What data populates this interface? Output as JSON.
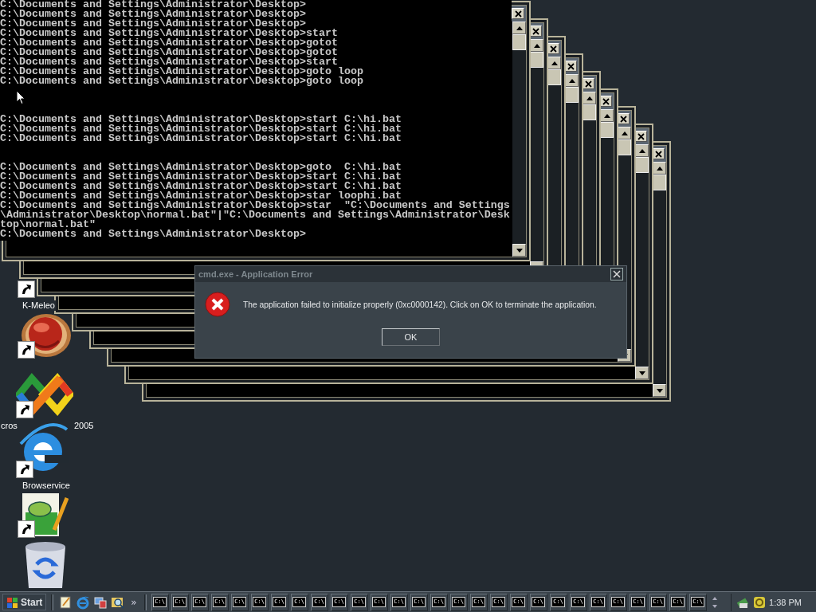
{
  "console": {
    "blocks": [
      [
        "C:\\Documents and Settings\\Administrator\\Desktop>",
        "C:\\Documents and Settings\\Administrator\\Desktop>",
        "C:\\Documents and Settings\\Administrator\\Desktop>",
        "C:\\Documents and Settings\\Administrator\\Desktop>start",
        "C:\\Documents and Settings\\Administrator\\Desktop>gotot",
        "C:\\Documents and Settings\\Administrator\\Desktop>gotot",
        "C:\\Documents and Settings\\Administrator\\Desktop>start",
        "C:\\Documents and Settings\\Administrator\\Desktop>goto loop",
        "C:\\Documents and Settings\\Administrator\\Desktop>goto loop"
      ],
      [
        "C:\\Documents and Settings\\Administrator\\Desktop>start C:\\hi.bat",
        "C:\\Documents and Settings\\Administrator\\Desktop>start C:\\hi.bat",
        "C:\\Documents and Settings\\Administrator\\Desktop>start C:\\hi.bat"
      ],
      [
        "C:\\Documents and Settings\\Administrator\\Desktop>goto  C:\\hi.bat",
        "C:\\Documents and Settings\\Administrator\\Desktop>start C:\\hi.bat",
        "C:\\Documents and Settings\\Administrator\\Desktop>start C:\\hi.bat",
        "C:\\Documents and Settings\\Administrator\\Desktop>star loophi.bat",
        "C:\\Documents and Settings\\Administrator\\Desktop>star  \"C:\\Documents and Settings",
        "\\Administrator\\Desktop\\normal.bat\"|\"C:\\Documents and Settings\\Administrator\\Desk",
        "top\\normal.bat\"",
        "C:\\Documents and Settings\\Administrator\\Desktop>"
      ]
    ]
  },
  "background_windows": [
    {
      "kind": "console"
    },
    {
      "kind": "console"
    },
    {
      "kind": "console"
    },
    {
      "kind": "console"
    },
    {
      "kind": "console"
    },
    {
      "kind": "console"
    },
    {
      "kind": "console"
    },
    {
      "kind": "console"
    },
    {
      "kind": "console"
    }
  ],
  "desktop_icons": [
    {
      "kind": "covered",
      "shortcut": true,
      "labels": [
        "K-Meleo"
      ]
    },
    {
      "kind": "ball",
      "shortcut": true
    },
    {
      "kind": "knot",
      "shortcut": true,
      "labels": [
        "cros",
        "2005"
      ]
    },
    {
      "kind": "e",
      "shortcut": true,
      "labels": [
        "Browservice"
      ]
    },
    {
      "kind": "notepad",
      "shortcut": true
    },
    {
      "kind": "bin",
      "shortcut": false
    }
  ],
  "dialog": {
    "title": "cmd.exe - Application Error",
    "active": false,
    "message": "The application failed to initialize properly (0xc0000142). Click on OK to terminate the application.",
    "button": "OK"
  },
  "taskbar": {
    "start": "Start",
    "quick_launch": [
      {
        "kind": "notepad"
      },
      {
        "kind": "e"
      },
      {
        "kind": "network"
      },
      {
        "kind": "search"
      }
    ],
    "chevron": "»",
    "tasks": [
      {
        "icon_text": "C:\\"
      },
      {
        "icon_text": "C:\\"
      },
      {
        "icon_text": "C:\\"
      },
      {
        "icon_text": "C:\\"
      },
      {
        "icon_text": "C:\\"
      },
      {
        "icon_text": "C:\\"
      },
      {
        "icon_text": "C:\\"
      },
      {
        "icon_text": "C:\\"
      },
      {
        "icon_text": "C:\\"
      },
      {
        "icon_text": "C:\\"
      },
      {
        "icon_text": "C:\\"
      },
      {
        "icon_text": "C:\\"
      },
      {
        "icon_text": "C:\\"
      },
      {
        "icon_text": "C:\\"
      },
      {
        "icon_text": "C:\\"
      },
      {
        "icon_text": "C:\\"
      },
      {
        "icon_text": "C:\\"
      },
      {
        "icon_text": "C:\\"
      },
      {
        "icon_text": "C:\\"
      },
      {
        "icon_text": "C:\\"
      },
      {
        "icon_text": "C:\\"
      },
      {
        "icon_text": "C:\\"
      },
      {
        "icon_text": "C:\\"
      },
      {
        "icon_text": "C:\\"
      },
      {
        "icon_text": "C:\\"
      },
      {
        "icon_text": "C:\\"
      },
      {
        "icon_text": "C:\\"
      },
      {
        "icon_text": "C:\\"
      }
    ],
    "tray": [
      {
        "kind": "network"
      },
      {
        "kind": "security"
      }
    ],
    "clock": "1:38 PM"
  }
}
